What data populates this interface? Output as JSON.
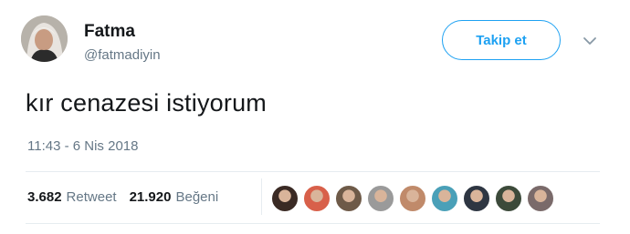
{
  "author": {
    "name": "Fatma",
    "handle": "@fatmadiyin"
  },
  "follow_label": "Takip et",
  "tweet": {
    "text": "kır cenazesi istiyorum",
    "timestamp": "11:43 - 6 Nis 2018"
  },
  "stats": {
    "retweets": "3.682",
    "retweets_label": "Retweet",
    "likes": "21.920",
    "likes_label": "Beğeni"
  },
  "likers": [
    {
      "color": "#3a2a24"
    },
    {
      "color": "#d8604a"
    },
    {
      "color": "#6e5a48"
    },
    {
      "color": "#9a9a9a"
    },
    {
      "color": "#c08a6a"
    },
    {
      "color": "#4aa0b8"
    },
    {
      "color": "#2e3642"
    },
    {
      "color": "#3c4a3a"
    },
    {
      "color": "#7a6a6a"
    }
  ],
  "colors": {
    "accent": "#1da1f2",
    "secondary_text": "#657786"
  }
}
